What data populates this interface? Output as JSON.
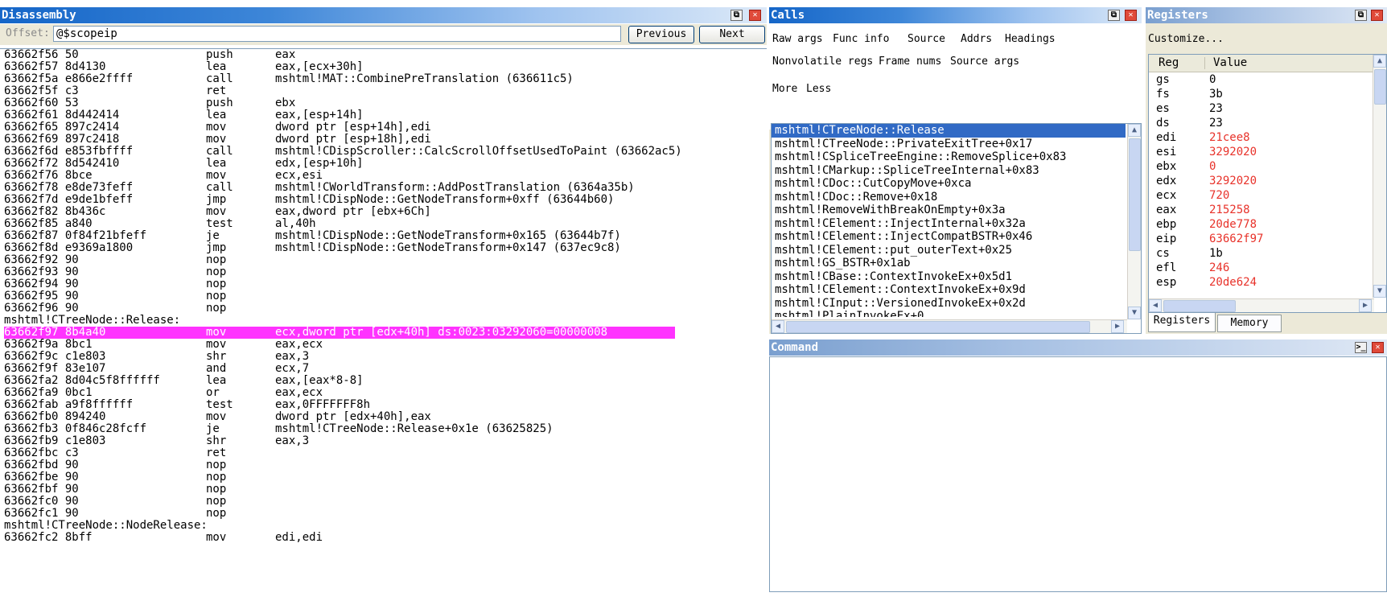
{
  "disassembly": {
    "title": "Disassembly",
    "offset_label": "Offset:",
    "offset_value": "@$scopeip",
    "previous_label": "Previous",
    "next_label": "Next",
    "rows": [
      {
        "addr": "63662f56 50",
        "op": "push",
        "arg": "eax"
      },
      {
        "addr": "63662f57 8d4130",
        "op": "lea",
        "arg": "eax,[ecx+30h]"
      },
      {
        "addr": "63662f5a e866e2ffff",
        "op": "call",
        "arg": "mshtml!MAT::CombinePreTranslation (636611c5)"
      },
      {
        "addr": "63662f5f c3",
        "op": "ret",
        "arg": ""
      },
      {
        "addr": "63662f60 53",
        "op": "push",
        "arg": "ebx"
      },
      {
        "addr": "63662f61 8d442414",
        "op": "lea",
        "arg": "eax,[esp+14h]"
      },
      {
        "addr": "63662f65 897c2414",
        "op": "mov",
        "arg": "dword ptr [esp+14h],edi"
      },
      {
        "addr": "63662f69 897c2418",
        "op": "mov",
        "arg": "dword ptr [esp+18h],edi"
      },
      {
        "addr": "63662f6d e853fbffff",
        "op": "call",
        "arg": "mshtml!CDispScroller::CalcScrollOffsetUsedToPaint (63662ac5)"
      },
      {
        "addr": "63662f72 8d542410",
        "op": "lea",
        "arg": "edx,[esp+10h]"
      },
      {
        "addr": "63662f76 8bce",
        "op": "mov",
        "arg": "ecx,esi"
      },
      {
        "addr": "63662f78 e8de73feff",
        "op": "call",
        "arg": "mshtml!CWorldTransform::AddPostTranslation (6364a35b)"
      },
      {
        "addr": "63662f7d e9de1bfeff",
        "op": "jmp",
        "arg": "mshtml!CDispNode::GetNodeTransform+0xff (63644b60)"
      },
      {
        "addr": "63662f82 8b436c",
        "op": "mov",
        "arg": "eax,dword ptr [ebx+6Ch]"
      },
      {
        "addr": "63662f85 a840",
        "op": "test",
        "arg": "al,40h"
      },
      {
        "addr": "63662f87 0f84f21bfeff",
        "op": "je",
        "arg": "mshtml!CDispNode::GetNodeTransform+0x165 (63644b7f)"
      },
      {
        "addr": "63662f8d e9369a1800",
        "op": "jmp",
        "arg": "mshtml!CDispNode::GetNodeTransform+0x147 (637ec9c8)"
      },
      {
        "addr": "63662f92 90",
        "op": "nop",
        "arg": ""
      },
      {
        "addr": "63662f93 90",
        "op": "nop",
        "arg": ""
      },
      {
        "addr": "63662f94 90",
        "op": "nop",
        "arg": ""
      },
      {
        "addr": "63662f95 90",
        "op": "nop",
        "arg": ""
      },
      {
        "addr": "63662f96 90",
        "op": "nop",
        "arg": ""
      },
      {
        "label": "mshtml!CTreeNode::Release:"
      },
      {
        "addr": "63662f97 8b4a40",
        "op": "mov",
        "arg": "ecx,dword ptr [edx+40h] ds:0023:03292060=00000008",
        "current": true
      },
      {
        "addr": "63662f9a 8bc1",
        "op": "mov",
        "arg": "eax,ecx"
      },
      {
        "addr": "63662f9c c1e803",
        "op": "shr",
        "arg": "eax,3"
      },
      {
        "addr": "63662f9f 83e107",
        "op": "and",
        "arg": "ecx,7"
      },
      {
        "addr": "63662fa2 8d04c5f8ffffff",
        "op": "lea",
        "arg": "eax,[eax*8-8]"
      },
      {
        "addr": "63662fa9 0bc1",
        "op": "or",
        "arg": "eax,ecx"
      },
      {
        "addr": "63662fab a9f8ffffff",
        "op": "test",
        "arg": "eax,0FFFFFFF8h"
      },
      {
        "addr": "63662fb0 894240",
        "op": "mov",
        "arg": "dword ptr [edx+40h],eax"
      },
      {
        "addr": "63662fb3 0f846c28fcff",
        "op": "je",
        "arg": "mshtml!CTreeNode::Release+0x1e (63625825)"
      },
      {
        "addr": "63662fb9 c1e803",
        "op": "shr",
        "arg": "eax,3"
      },
      {
        "addr": "63662fbc c3",
        "op": "ret",
        "arg": ""
      },
      {
        "addr": "63662fbd 90",
        "op": "nop",
        "arg": ""
      },
      {
        "addr": "63662fbe 90",
        "op": "nop",
        "arg": ""
      },
      {
        "addr": "63662fbf 90",
        "op": "nop",
        "arg": ""
      },
      {
        "addr": "63662fc0 90",
        "op": "nop",
        "arg": ""
      },
      {
        "addr": "63662fc1 90",
        "op": "nop",
        "arg": ""
      },
      {
        "label": "mshtml!CTreeNode::NodeRelease:"
      },
      {
        "addr": "63662fc2 8bff",
        "op": "mov",
        "arg": "edi,edi"
      }
    ]
  },
  "calls": {
    "title": "Calls",
    "options_row1": [
      "Raw args",
      "Func info",
      "Source",
      "Addrs",
      "Headings"
    ],
    "options_row2": [
      "Nonvolatile regs",
      "Frame nums",
      "Source args"
    ],
    "options_row3": [
      "More",
      "Less"
    ],
    "frames": [
      "mshtml!CTreeNode::Release",
      "mshtml!CTreeNode::PrivateExitTree+0x17",
      "mshtml!CSpliceTreeEngine::RemoveSplice+0x83",
      "mshtml!CMarkup::SpliceTreeInternal+0x83",
      "mshtml!CDoc::CutCopyMove+0xca",
      "mshtml!CDoc::Remove+0x18",
      "mshtml!RemoveWithBreakOnEmpty+0x3a",
      "mshtml!CElement::InjectInternal+0x32a",
      "mshtml!CElement::InjectCompatBSTR+0x46",
      "mshtml!CElement::put_outerText+0x25",
      "mshtml!GS_BSTR+0x1ab",
      "mshtml!CBase::ContextInvokeEx+0x5d1",
      "mshtml!CElement::ContextInvokeEx+0x9d",
      "mshtml!CInput::VersionedInvokeEx+0x2d",
      "mshtml!PlainInvokeEx+0"
    ]
  },
  "registers": {
    "title": "Registers",
    "customize_label": "Customize...",
    "col_reg": "Reg",
    "col_value": "Value",
    "changed_color": "#e8322a",
    "rows": [
      {
        "reg": "gs",
        "value": "0",
        "changed": false
      },
      {
        "reg": "fs",
        "value": "3b",
        "changed": false
      },
      {
        "reg": "es",
        "value": "23",
        "changed": false
      },
      {
        "reg": "ds",
        "value": "23",
        "changed": false
      },
      {
        "reg": "edi",
        "value": "21cee8",
        "changed": true
      },
      {
        "reg": "esi",
        "value": "3292020",
        "changed": true
      },
      {
        "reg": "ebx",
        "value": "0",
        "changed": true
      },
      {
        "reg": "edx",
        "value": "3292020",
        "changed": true
      },
      {
        "reg": "ecx",
        "value": "720",
        "changed": true
      },
      {
        "reg": "eax",
        "value": "215258",
        "changed": true
      },
      {
        "reg": "ebp",
        "value": "20de778",
        "changed": true
      },
      {
        "reg": "eip",
        "value": "63662f97",
        "changed": true
      },
      {
        "reg": "cs",
        "value": "1b",
        "changed": false
      },
      {
        "reg": "efl",
        "value": "246",
        "changed": true
      },
      {
        "reg": "esp",
        "value": "20de624",
        "changed": true
      }
    ],
    "tabs": [
      "Registers",
      "Memory"
    ]
  },
  "command": {
    "title": "Command"
  },
  "colors": {
    "current_line": "#ff33ff",
    "selection": "#316ac5",
    "title_blue": "#1566c8"
  },
  "icons": {
    "dock": "dock-icon",
    "close": "close-icon",
    "command_prompt": "prompt-icon"
  }
}
